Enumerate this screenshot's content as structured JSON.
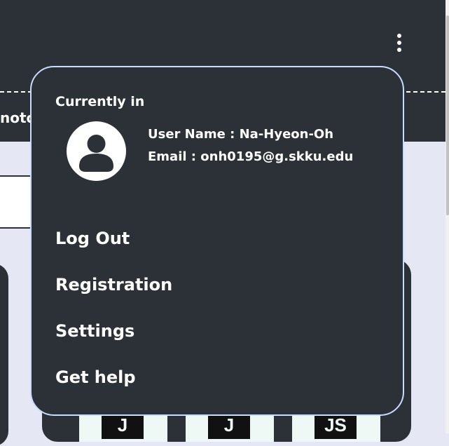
{
  "header": {
    "partial_tab_text": "noto",
    "menu_icon": "kebab-vertical-icon"
  },
  "cards": {
    "badges": [
      "J",
      "J",
      "JS"
    ]
  },
  "account_menu": {
    "heading": "Currently in",
    "avatar_icon": "user-avatar-icon",
    "user_name": "User Name : Na-Hyeon-Oh",
    "email": "Email : onh0195@g.skku.edu",
    "items": [
      {
        "label": "Log Out"
      },
      {
        "label": "Registration"
      },
      {
        "label": "Settings"
      },
      {
        "label": "Get help"
      }
    ]
  },
  "colors": {
    "dark": "#2b3137",
    "page_bg": "#e6e7f4",
    "popup_border": "#c8dcff",
    "text": "#ffffff"
  }
}
